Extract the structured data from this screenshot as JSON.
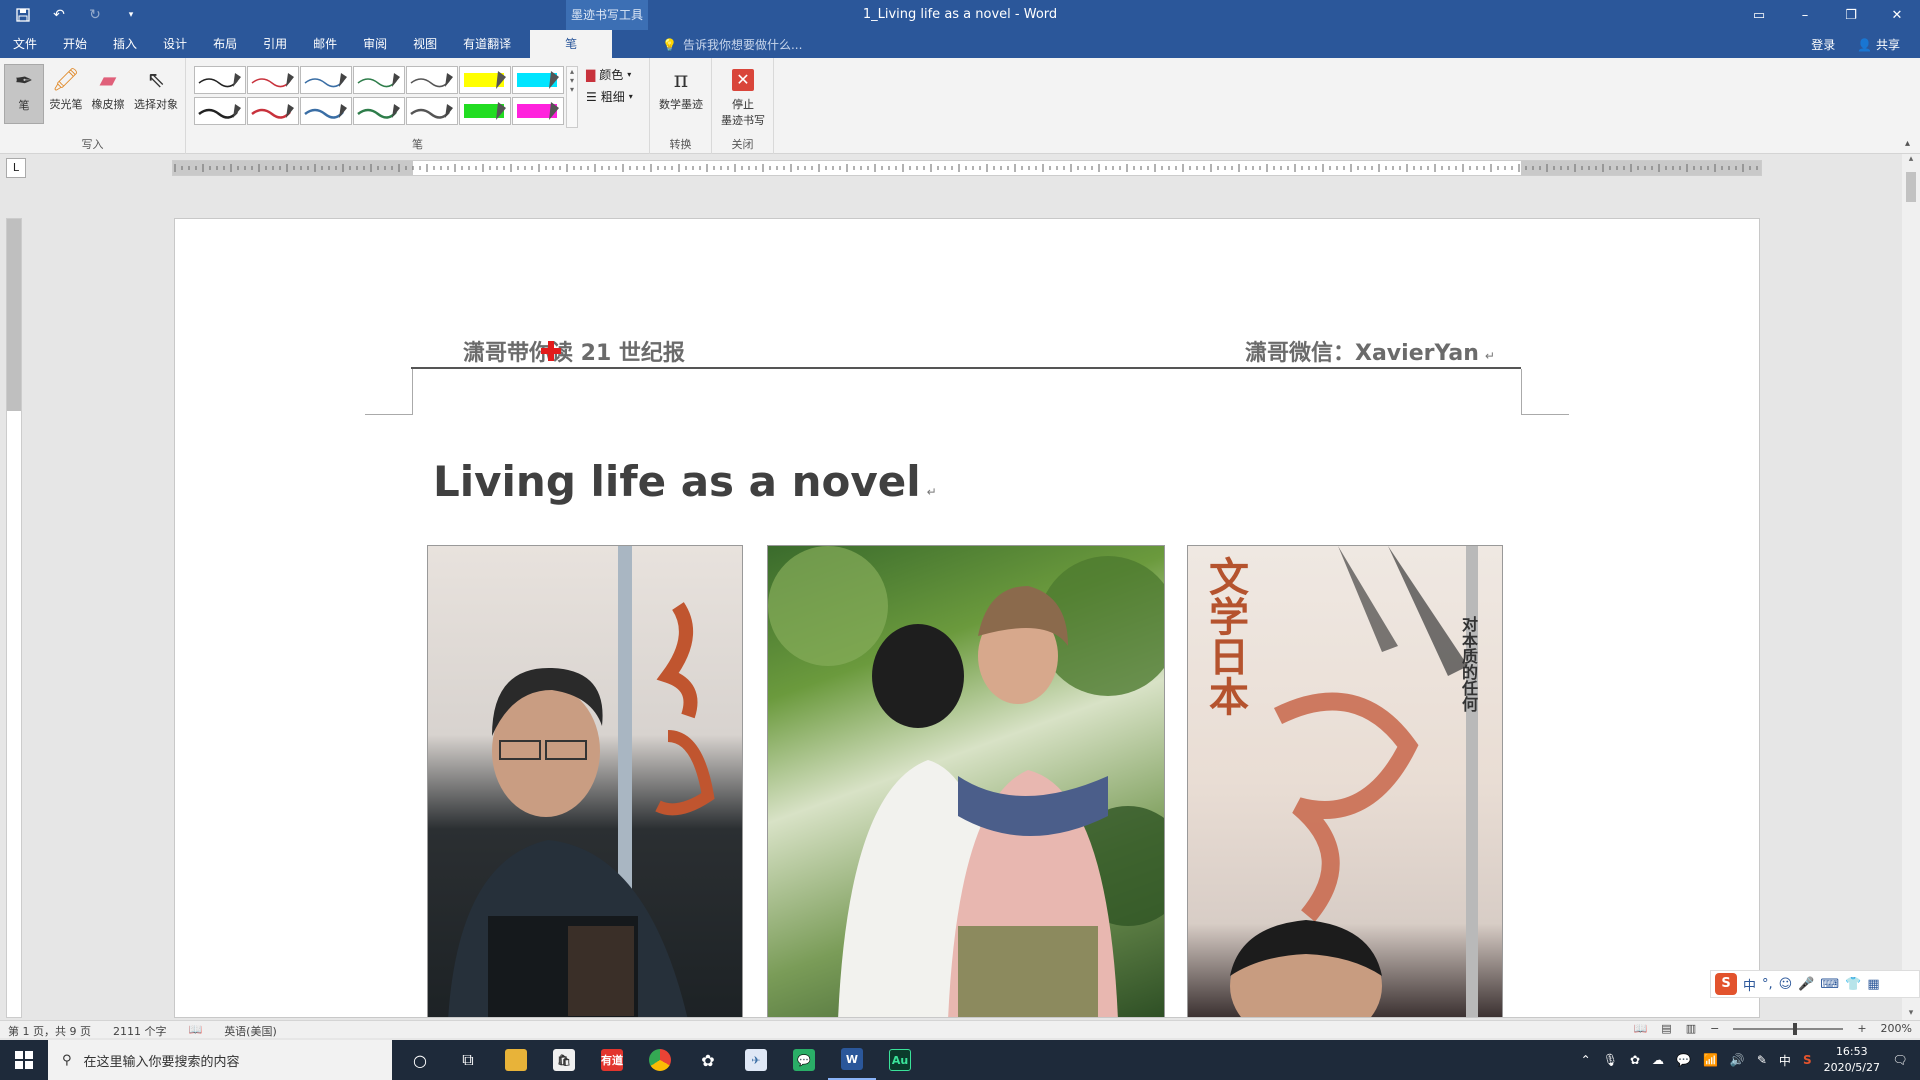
{
  "window": {
    "title": "1_Living life as a novel - Word",
    "context_tab_group": "墨迹书写工具"
  },
  "ribbon_tabs": [
    "文件",
    "开始",
    "插入",
    "设计",
    "布局",
    "引用",
    "邮件",
    "审阅",
    "视图",
    "有道翻译"
  ],
  "active_tab": "笔",
  "tell_me": "告诉我你想要做什么...",
  "account": {
    "login": "登录",
    "share": "共享"
  },
  "ribbon": {
    "write_group": {
      "label": "写入",
      "buttons": [
        "笔",
        "荧光笔",
        "橡皮擦",
        "选择对象"
      ]
    },
    "pens_group": {
      "label": "笔",
      "color_label": "颜色",
      "thickness_label": "粗细"
    },
    "convert_group": {
      "label": "转换",
      "button": "数学墨迹"
    },
    "close_group": {
      "label": "关闭",
      "button_line1": "停止",
      "button_line2": "墨迹书写"
    }
  },
  "pen_colors": [
    "#222222",
    "#c8323c",
    "#3a6ea5",
    "#2e7d4a",
    "#555555",
    "#ffff00",
    "#00e5ff",
    "#222222",
    "#c8323c",
    "#3a6ea5",
    "#2e7d4a",
    "#555555",
    "#22dd22",
    "#ff22dd"
  ],
  "ruler_corner": "L",
  "document": {
    "header_left": "潇哥带你读 21 世纪报",
    "header_right": "潇哥微信：XavierYan",
    "heading": "Living life as a novel",
    "para_mark": "↵",
    "photo3_text_1": "文学日本",
    "photo3_text_2": "对本质的任何"
  },
  "status": {
    "page": "第 1 页，共 9 页",
    "words": "2111 个字",
    "language": "英语(美国)",
    "zoom": "200%"
  },
  "ime": {
    "lang": "中"
  },
  "taskbar": {
    "search_placeholder": "在这里输入你要搜索的内容",
    "apps": [
      "file-explorer",
      "store",
      "youdao",
      "chrome",
      "app-flower",
      "app-bird",
      "wechat",
      "word",
      "audition"
    ],
    "youdao_label": "有道",
    "word_label": "W",
    "audition_label": "Au",
    "tray_lang": "中",
    "time": "16:53",
    "date": "2020/5/27"
  }
}
